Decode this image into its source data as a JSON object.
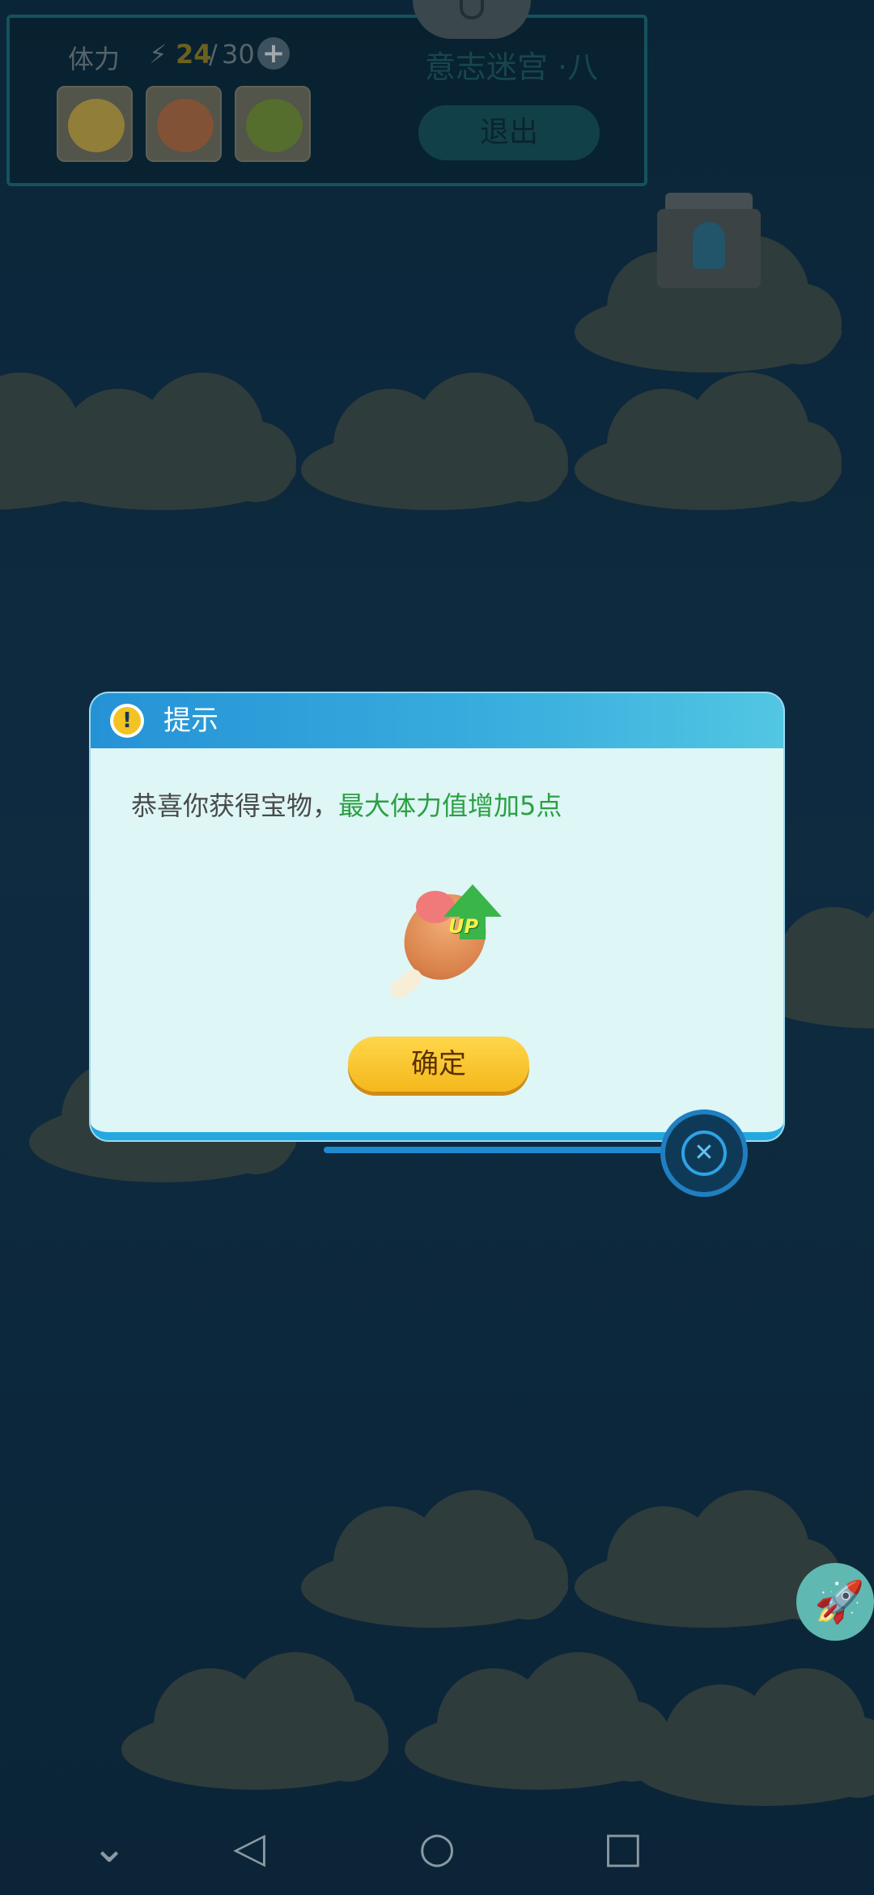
{
  "hud": {
    "stamina_label": "体力",
    "stamina_current": "24",
    "stamina_separator": "/",
    "stamina_max": "30",
    "add_icon": "+",
    "level_title": "意志迷宫 ·八",
    "exit_label": "退出",
    "items": [
      "cat-face-item-icon",
      "drumstick-item-icon",
      "exp-potion-item-icon"
    ]
  },
  "dialog": {
    "title": "提示",
    "warn_icon": "!",
    "message_prefix": "恭喜你获得宝物，",
    "message_highlight": "最大体力值增加5点",
    "reward_icon": "drumstick-up-icon",
    "reward_badge": "UP",
    "confirm_label": "确定",
    "close_icon": "✕",
    "colors": {
      "header": "#2592d6",
      "highlight": "#2ba043",
      "confirm": "#f4b81c"
    }
  },
  "rocket_icon": "🚀",
  "navbar": {
    "down": "⌄",
    "back": "◁",
    "home": "○",
    "recent": "□"
  }
}
